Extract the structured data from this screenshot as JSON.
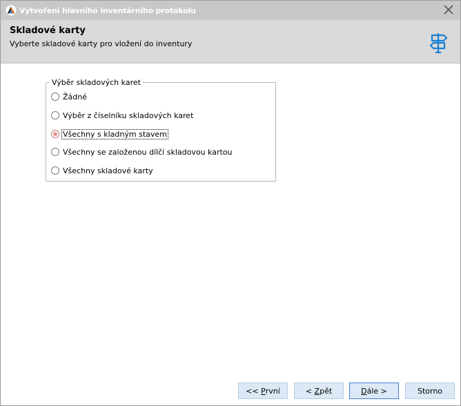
{
  "window": {
    "title": "Vytvoření hlavního inventárního protokolu",
    "app_icon": "app-logo-icon",
    "close_icon": "close-icon"
  },
  "header": {
    "title": "Skladové karty",
    "subtitle": "Vyberte skladové karty pro vložení do inventury",
    "icon": "signpost-icon",
    "icon_color": "#1a7fd4"
  },
  "group": {
    "legend": "Výběr skladových karet",
    "options": [
      {
        "label": "Žádné",
        "checked": false
      },
      {
        "label": "Výběr z číselníku skladových karet",
        "checked": false
      },
      {
        "label": "Všechny s kladným stavem",
        "checked": true
      },
      {
        "label": "Všechny se založenou dílčí skladovou kartou",
        "checked": false
      },
      {
        "label": "Všechny skladové karty",
        "checked": false
      }
    ]
  },
  "buttons": {
    "first": {
      "prefix": "<< ",
      "accel": "P",
      "rest": "rvní"
    },
    "back": {
      "prefix": "< ",
      "accel": "Z",
      "rest": "pět"
    },
    "next": {
      "prefix": "",
      "accel": "D",
      "rest": "ále >"
    },
    "cancel": {
      "label": "Storno"
    }
  }
}
